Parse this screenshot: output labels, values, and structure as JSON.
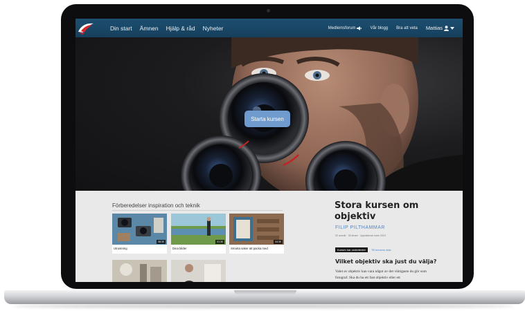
{
  "nav": {
    "primary": [
      "Din start",
      "Ämnen",
      "Hjälp & råd",
      "Nyheter"
    ],
    "secondary": [
      {
        "label": "Medlemsforum",
        "icon": "megaphone-icon"
      },
      {
        "label": "Vår blogg"
      },
      {
        "label": "Bra att veta"
      }
    ],
    "user": {
      "label": "Mattias",
      "icon": "user-icon",
      "caret": "chevron-down-icon"
    }
  },
  "hero": {
    "cta_label": "Starta kursen"
  },
  "section": {
    "title": "Förberedelser inspiration och teknik",
    "videos": [
      {
        "caption": "Utrustning",
        "duration": "08:30"
      },
      {
        "caption": "Dina bilder",
        "duration": "01:30"
      },
      {
        "caption": "Smarta saker att packa med",
        "duration": "04:30"
      },
      {
        "caption": ""
      },
      {
        "caption": ""
      }
    ]
  },
  "course": {
    "title": "Stora kursen om objektiv",
    "author": "FILIP PILTHAMMAR",
    "meta": "32 avsnitt · 35 lärare · Uppdaterad mars 2019",
    "badge": "Kursen har undertexter",
    "badge_link": "Till kursens sida",
    "question": "Vilket objektiv ska just du välja?",
    "body": "Valet av objektiv kan vara något av det viktigaste du gör som fotograf. Ska du ha ett fast objektiv eller ett"
  },
  "colors": {
    "nav": "#1b4a6b",
    "cta": "#6f9bcf",
    "accent": "#4f86c8",
    "content_bg": "#e9e9e9"
  }
}
